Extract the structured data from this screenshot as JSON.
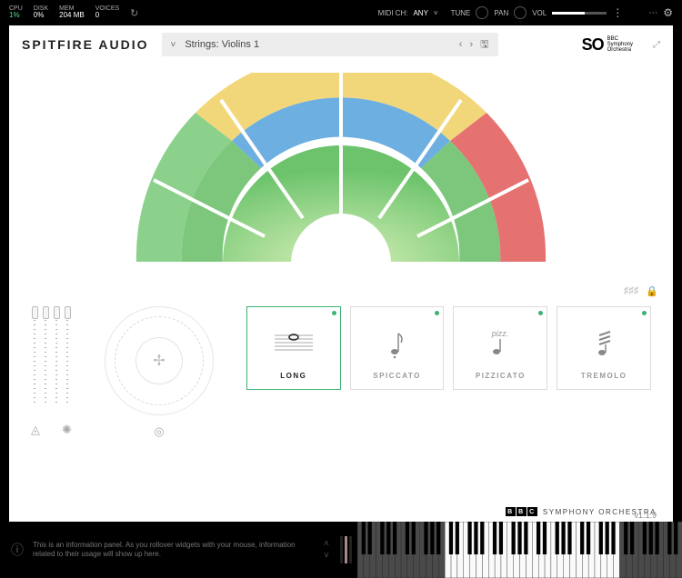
{
  "status": {
    "cpu_label": "CPU",
    "cpu_value": "1%",
    "disk_label": "DISK",
    "disk_value": "0%",
    "mem_label": "MEM",
    "mem_value": "204 MB",
    "voices_label": "VOICES",
    "voices_value": "0",
    "midi_label": "MIDI CH:",
    "midi_value": "ANY",
    "tune": "TUNE",
    "pan": "PAN",
    "vol": "VOL"
  },
  "header": {
    "brand": "SPITFIRE AUDIO",
    "preset": "Strings: Violins 1",
    "logo_mark": "SO",
    "logo_line1": "BBC",
    "logo_line2": "Symphony",
    "logo_line3": "Orchestra"
  },
  "articulations": [
    {
      "label": "LONG",
      "active": true
    },
    {
      "label": "SPICCATO",
      "active": false
    },
    {
      "label": "PIZZICATO",
      "active": false,
      "ann": "pizz."
    },
    {
      "label": "TREMOLO",
      "active": false
    }
  ],
  "footer": {
    "bbc": [
      "B",
      "B",
      "C"
    ],
    "orchestra": "SYMPHONY ORCHESTRA",
    "version": "v1.1.9"
  },
  "info": {
    "text": "This is an information panel. As you rollover widgets with your mouse, information related to their usage will show up here."
  }
}
